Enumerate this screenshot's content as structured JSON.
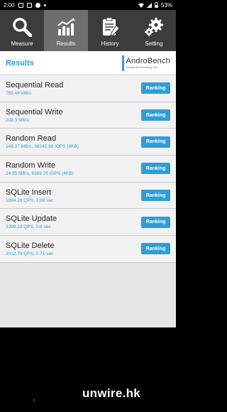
{
  "status": {
    "time": "2:00",
    "battery": "53%"
  },
  "tabs": [
    {
      "label": "Measure",
      "icon": "search-icon"
    },
    {
      "label": "Results",
      "icon": "chart-icon",
      "active": true
    },
    {
      "label": "History",
      "icon": "clipboard-icon"
    },
    {
      "label": "Setting",
      "icon": "gears-icon"
    }
  ],
  "results": {
    "title": "Results",
    "logo_name": "AndroBench",
    "logo_sub": "Storage Benchmarking Tool",
    "ranking_label": "Ranking",
    "items": [
      {
        "name": "Sequential Read",
        "value": "755.44 MB/s"
      },
      {
        "name": "Sequential Write",
        "value": "206.3 MB/s"
      },
      {
        "name": "Random Read",
        "value": "149.37 MB/s, 38240.99 IOPS (4KB)"
      },
      {
        "name": "Random Write",
        "value": "24.95 MB/s, 6389.25 IOPS (4KB)"
      },
      {
        "name": "SQLite Insert",
        "value": "1864.28 QPS, 1.09 sec"
      },
      {
        "name": "SQLite Update",
        "value": "3399.29 QPS, 0.6 sec"
      },
      {
        "name": "SQLite Delete",
        "value": "3013.78 QPS, 0.71 sec"
      }
    ]
  },
  "watermark": "unwire.hk",
  "colors": {
    "accent": "#2e9ed6",
    "tabbar": "#3c3c3c",
    "tab_active": "#6e6e6e"
  }
}
